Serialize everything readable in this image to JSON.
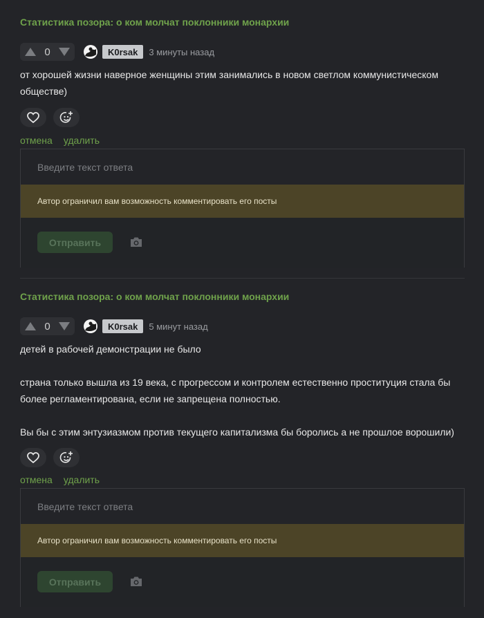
{
  "comments": [
    {
      "post_title": "Статистика позора: о ком молчат поклонники монархии",
      "rating": "0",
      "username": "K0rsak",
      "time": "3 минуты назад",
      "body": [
        "от хорошей жизни наверное женщины этим занимались в новом светлом коммунистическом обществе)"
      ],
      "actions": {
        "cancel": "отмена",
        "delete": "удалить"
      },
      "reply": {
        "placeholder": "Введите текст ответа",
        "restriction": "Автор ограничил вам возможность комментировать его посты",
        "send_label": "Отправить"
      }
    },
    {
      "post_title": "Статистика позора: о ком молчат поклонники монархии",
      "rating": "0",
      "username": "K0rsak",
      "time": "5 минут назад",
      "body": [
        "детей в рабочей демонстрации не было",
        "",
        "страна только вышла из 19 века, с прогрессом и контролем естественно проституция стала бы более регламентирована, если не запрещена полностью.",
        "",
        "Вы бы с этим энтузиазмом против текущего капитализма бы боролись а не прошлое ворошили)"
      ],
      "actions": {
        "cancel": "отмена",
        "delete": "удалить"
      },
      "reply": {
        "placeholder": "Введите текст ответа",
        "restriction": "Автор ограничил вам возможность комментировать его посты",
        "send_label": "Отправить"
      }
    }
  ],
  "colors": {
    "accent_green": "#6fa24b",
    "restriction_bg": "#4c4427",
    "background": "#232428"
  },
  "icons": [
    "upvote-icon",
    "downvote-icon",
    "heart-icon",
    "emoji-add-icon",
    "camera-icon",
    "avatar-icon"
  ]
}
